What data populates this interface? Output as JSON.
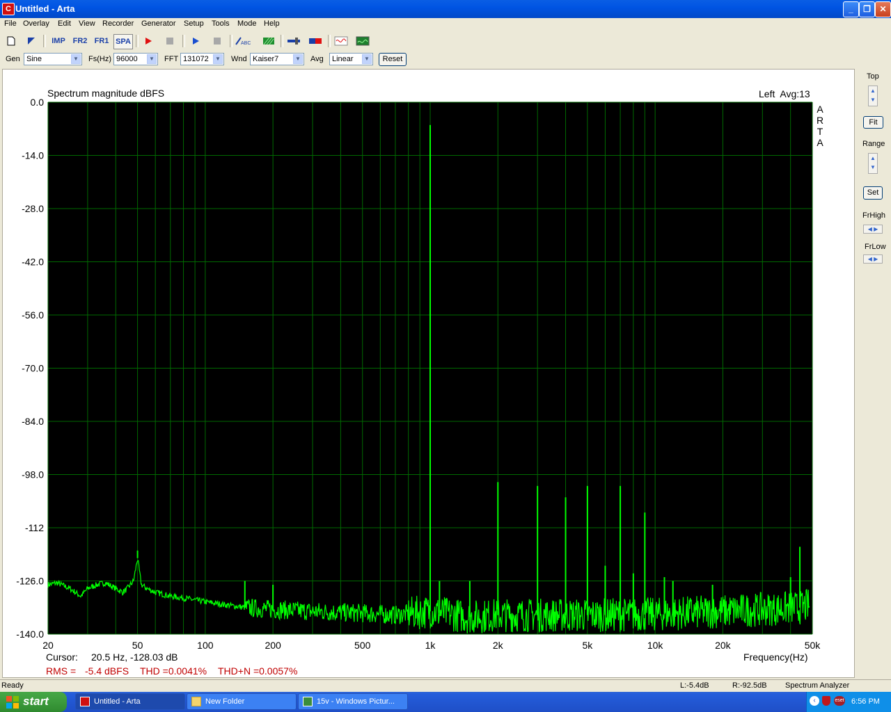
{
  "window": {
    "title": "Untitled - Arta",
    "app_icon": "C"
  },
  "menu": [
    "File",
    "Overlay",
    "Edit",
    "View",
    "Recorder",
    "Generator",
    "Setup",
    "Tools",
    "Mode",
    "Help"
  ],
  "toolbar": {
    "imp": "IMP",
    "fr2": "FR2",
    "fr1": "FR1",
    "spa": "SPA"
  },
  "controls": {
    "gen_label": "Gen",
    "gen_value": "Sine",
    "fs_label": "Fs(Hz)",
    "fs_value": "96000",
    "fft_label": "FFT",
    "fft_value": "131072",
    "wnd_label": "Wnd",
    "wnd_value": "Kaiser7",
    "avg_label": "Avg",
    "avg_value": "Linear",
    "reset_label": "Reset"
  },
  "side": {
    "top_label": "Top",
    "fit_label": "Fit",
    "range_label": "Range",
    "set_label": "Set",
    "frhigh_label": "FrHigh",
    "frlow_label": "FrLow"
  },
  "plot": {
    "title": "Spectrum magnitude dBFS",
    "channel": "Left  Avg:13",
    "arta_letters": [
      "A",
      "R",
      "T",
      "A"
    ],
    "cursor_label": "Cursor:",
    "cursor_value": "20.5 Hz, -128.03 dB",
    "rms_label": "RMS =",
    "rms_value": "-5.4 dBFS",
    "thd": "THD =0.0041%",
    "thdn": "THD+N =0.0057%",
    "xlabel": "Frequency(Hz)"
  },
  "chart_data": {
    "type": "line",
    "title": "Spectrum magnitude dBFS",
    "xlabel": "Frequency(Hz)",
    "ylabel": "",
    "x_scale": "log",
    "xlim": [
      20,
      50000
    ],
    "ylim": [
      -140,
      0
    ],
    "y_ticks": [
      "0.0",
      "-14.0",
      "-28.0",
      "-42.0",
      "-56.0",
      "-70.0",
      "-84.0",
      "-98.0",
      "-112",
      "-126.0",
      "-140.0"
    ],
    "y_tick_values": [
      0,
      -14,
      -28,
      -42,
      -56,
      -70,
      -84,
      -98,
      -112,
      -126,
      -140
    ],
    "x_ticks": [
      "20",
      "50",
      "100",
      "200",
      "500",
      "1k",
      "2k",
      "5k",
      "10k",
      "20k",
      "50k"
    ],
    "x_tick_values": [
      20,
      50,
      100,
      200,
      500,
      1000,
      2000,
      5000,
      10000,
      20000,
      50000
    ],
    "grid": true,
    "background": "#000000",
    "trace_color": "#00FF00",
    "grid_color": "#006A00",
    "noise_floor": [
      [
        20,
        -127
      ],
      [
        22,
        -126.5
      ],
      [
        25,
        -128
      ],
      [
        28,
        -130
      ],
      [
        30,
        -128
      ],
      [
        33,
        -127
      ],
      [
        36,
        -126.5
      ],
      [
        40,
        -128
      ],
      [
        43,
        -129
      ],
      [
        45,
        -128
      ],
      [
        48,
        -126
      ],
      [
        50,
        -120
      ],
      [
        52,
        -127
      ],
      [
        55,
        -128
      ],
      [
        60,
        -129
      ],
      [
        65,
        -129.5
      ],
      [
        70,
        -130
      ],
      [
        80,
        -130.5
      ],
      [
        100,
        -131.5
      ],
      [
        130,
        -132.5
      ],
      [
        150,
        -133
      ],
      [
        200,
        -133.5
      ],
      [
        300,
        -134
      ],
      [
        500,
        -134.5
      ],
      [
        700,
        -135
      ],
      [
        1000,
        -134
      ],
      [
        1500,
        -135.5
      ],
      [
        2000,
        -135
      ],
      [
        3000,
        -135
      ],
      [
        5000,
        -135
      ],
      [
        10000,
        -134.8
      ],
      [
        20000,
        -134
      ],
      [
        30000,
        -133.5
      ],
      [
        45000,
        -133
      ],
      [
        48000,
        -132.5
      ]
    ],
    "peaks": [
      {
        "freq": 50,
        "level": -118
      },
      {
        "freq": 150,
        "level": -126
      },
      {
        "freq": 200,
        "level": -127
      },
      {
        "freq": 1000,
        "level": -6
      },
      {
        "freq": 2000,
        "level": -100
      },
      {
        "freq": 3000,
        "level": -101
      },
      {
        "freq": 4000,
        "level": -104
      },
      {
        "freq": 5000,
        "level": -101
      },
      {
        "freq": 7000,
        "level": -101
      },
      {
        "freq": 9000,
        "level": -108
      },
      {
        "freq": 1100,
        "level": -126
      },
      {
        "freq": 1500,
        "level": -126
      },
      {
        "freq": 6000,
        "level": -122
      },
      {
        "freq": 8000,
        "level": -124
      },
      {
        "freq": 11000,
        "level": -125
      },
      {
        "freq": 12000,
        "level": -126
      },
      {
        "freq": 18000,
        "level": -127
      },
      {
        "freq": 44000,
        "level": -117
      },
      {
        "freq": 40000,
        "level": -125
      }
    ]
  },
  "status": {
    "left": "Ready",
    "level_l": "L:-5.4dB",
    "level_r": "R:-92.5dB",
    "mode": "Spectrum Analyzer"
  },
  "taskbar": {
    "start": "start",
    "tasks": [
      "Untitled - Arta",
      "New Folder",
      "15v - Windows Pictur..."
    ],
    "clock": "6:56 PM"
  }
}
